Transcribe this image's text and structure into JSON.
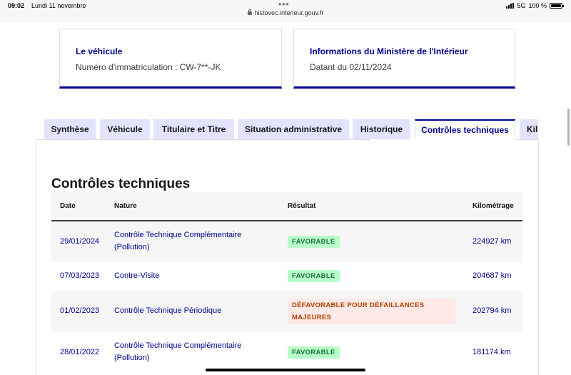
{
  "statusbar": {
    "time": "09:02",
    "date": "Lundi 11 novembre",
    "url": "histovec.interieur.gouv.fr",
    "network": "5G",
    "battery": "100 %"
  },
  "cards": {
    "vehicle": {
      "title": "Le véhicule",
      "text": "Numéro d'immatriculation : CW-7**-JK"
    },
    "ministry": {
      "title": "Informations du Ministère de l'Intérieur",
      "text": "Datant du 02/11/2024"
    }
  },
  "tabs": [
    {
      "label": "Synthèse"
    },
    {
      "label": "Véhicule"
    },
    {
      "label": "Titulaire et Titre"
    },
    {
      "label": "Situation administrative"
    },
    {
      "label": "Historique"
    },
    {
      "label": "Contrôles techniques",
      "active": true
    },
    {
      "label": "Kil"
    }
  ],
  "section": {
    "title": "Contrôles techniques"
  },
  "table": {
    "headers": {
      "date": "Date",
      "nature": "Nature",
      "resultat": "Résultat",
      "kilometrage": "Kilométrage"
    },
    "rows": [
      {
        "date": "29/01/2024",
        "nature_1": "Contrôle Technique Complémentaire",
        "nature_2": "(Pollution)",
        "result_1": "FAVORABLE",
        "result_2": "",
        "status": "ok",
        "km": "224927 km"
      },
      {
        "date": "07/03/2023",
        "nature_1": "Contre-Visite",
        "nature_2": "",
        "result_1": "FAVORABLE",
        "result_2": "",
        "status": "ok",
        "km": "204687 km"
      },
      {
        "date": "01/02/2023",
        "nature_1": "Contrôle Technique Périodique",
        "nature_2": "",
        "result_1": "DÉFAVORABLE POUR DÉFAILLANCES",
        "result_2": "MAJEURES",
        "status": "ko",
        "km": "202794 km"
      },
      {
        "date": "28/01/2022",
        "nature_1": "Contrôle Technique Complémentaire",
        "nature_2": "(Pollution)",
        "result_1": "FAVORABLE",
        "result_2": "",
        "status": "ok",
        "km": "181174 km"
      }
    ]
  },
  "colors": {
    "primary": "#000091",
    "tab_bg": "#e3e3fd",
    "success_bg": "#b8fec9",
    "success_text": "#18753c",
    "error_bg": "#ffe9e6",
    "error_text": "#b34000"
  }
}
